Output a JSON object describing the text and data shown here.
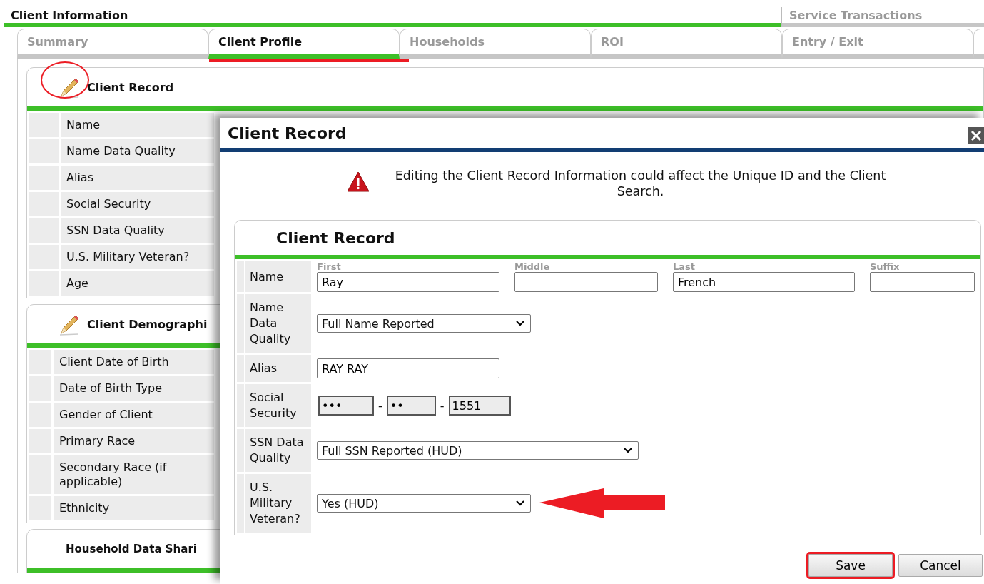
{
  "header_tabs": [
    {
      "label": "Client Information",
      "selected": true
    },
    {
      "label": "Service Transactions",
      "selected": false
    }
  ],
  "tabs": [
    {
      "label": "Summary",
      "selected": false,
      "marked": false
    },
    {
      "label": "Client Profile",
      "selected": true,
      "marked": true
    },
    {
      "label": "Households",
      "selected": false,
      "marked": false
    },
    {
      "label": "ROI",
      "selected": false,
      "marked": false
    },
    {
      "label": "Entry / Exit",
      "selected": false,
      "marked": false
    }
  ],
  "panels": [
    {
      "title": "Client Record",
      "editable": true,
      "marked": true,
      "rows": [
        "Name",
        "Name Data Quality",
        "Alias",
        "Social Security",
        "SSN Data Quality",
        "U.S. Military Veteran?",
        "Age"
      ]
    },
    {
      "title": "Client Demographi",
      "editable": true,
      "marked": false,
      "rows": [
        "Client Date of Birth",
        "Date of Birth Type",
        "Gender of Client",
        "Primary Race",
        "Secondary Race (if applicable)",
        "Ethnicity"
      ]
    },
    {
      "title": "Household Data Shari",
      "editable": false,
      "marked": false
    }
  ],
  "dialog": {
    "title": "Client Record",
    "warning": "Editing the Client Record Information could affect the Unique ID and the Client Search.",
    "section_title": "Client Record",
    "fields": [
      {
        "kind": "name",
        "label": "Name",
        "parts": [
          {
            "caption": "First",
            "value": "Ray"
          },
          {
            "caption": "Middle"
          },
          {
            "caption": "Last",
            "value": "French"
          },
          {
            "caption": "Suffix"
          }
        ]
      },
      {
        "kind": "select",
        "label": "Name Data Quality",
        "value": "Full Name Reported"
      },
      {
        "kind": "text",
        "label": "Alias",
        "value": "RAY RAY"
      },
      {
        "kind": "ssn",
        "label": "Social Security",
        "separator": "-",
        "parts": [
          "•••",
          "••",
          "1551"
        ]
      },
      {
        "kind": "select",
        "label": "SSN Data Quality",
        "value": "Full SSN Reported (HUD)"
      },
      {
        "kind": "select",
        "label": "U.S. Military Veteran?",
        "marked": true,
        "value": "Yes (HUD)"
      }
    ],
    "buttons": [
      {
        "label": "Save",
        "marked": true
      },
      {
        "label": "Cancel",
        "marked": false
      }
    ]
  }
}
